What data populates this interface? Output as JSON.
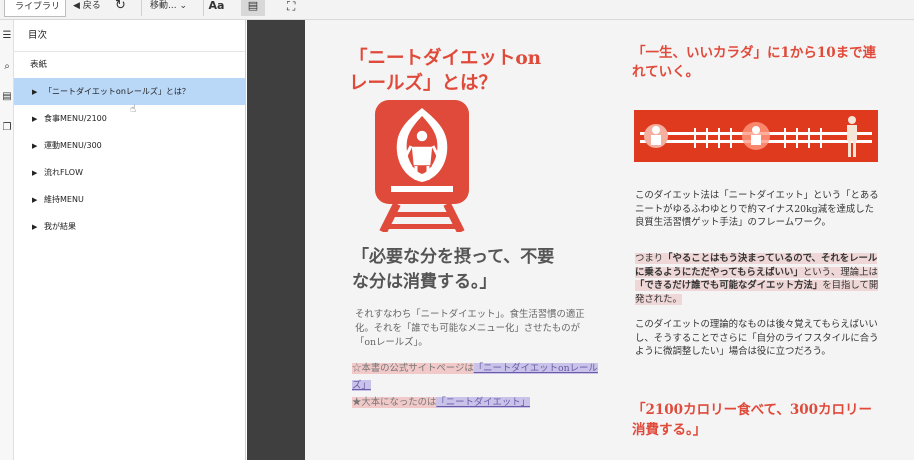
{
  "toolbar": {
    "library": "ライブラリ",
    "back": "◀ 戻る",
    "sync": "↻",
    "move": "移動... ⌄",
    "font": "Aa",
    "layout": "▤",
    "fullscreen": "⛶"
  },
  "rail": {
    "icons": [
      "toc-list-icon",
      "search-icon",
      "notes-icon",
      "pages-icon"
    ]
  },
  "toc": {
    "title": "目次",
    "cover": "表紙",
    "items": [
      {
        "label": "「ニートダイエットonレールズ」とは？",
        "selected": true
      },
      {
        "label": "食事MENU/2100",
        "selected": false
      },
      {
        "label": "運動MENU/300",
        "selected": false
      },
      {
        "label": "流れFLOW",
        "selected": false
      },
      {
        "label": "維持MENU",
        "selected": false
      },
      {
        "label": "我が結果",
        "selected": false
      }
    ]
  },
  "page": {
    "left_heading_1": "「ニートダイエットon",
    "left_heading_2": "レールズ」とは？",
    "tagline_1": "「必要な分を摂って、不要",
    "tagline_2": "な分は消費する。」",
    "body_left": "それすなわち「ニートダイエット」。食生活習慣の適正化。それを「誰でも可能なメニュー化」させたものが「onレールズ」。",
    "link1_prefix": "☆本書の公式サイトページは",
    "link1_text": "「ニートダイエットonレールズ」",
    "link2_prefix": "★大本になったのは",
    "link2_text": "「ニートダイエット」",
    "right_heading": "「一生、いいカラダ」に1から10まで連れていく。",
    "para1": "このダイエット法は「ニートダイエット」という「とあるニートがゆるふわゆとりで約マイナス20kg減を達成した良質生活習慣ゲット手法」のフレームワーク。",
    "para2_a": "つまり",
    "para2_b": "「やることはもう決まっているので、それをレールに乗るようにただやってもらえばいい」",
    "para2_c": "という、理論上は",
    "para2_d": "「できるだけ誰でも可能なダイエット方法」",
    "para2_e": "を目指して開発された。",
    "para3": "このダイエットの理論的なものは後々覚えてもらえばいいし、そうすることでさらに「自分のライフスタイルに合うように微調整したい」場合は役に立つだろう。",
    "bottom_heading": "「2100カロリー食べて、300カロリー消費する。」"
  },
  "colors": {
    "accent_red": "#e04a3a",
    "selection": "#b9d7f6",
    "highlight_pink": "#f1c9c9",
    "link_purple": "#c9c3ea"
  }
}
